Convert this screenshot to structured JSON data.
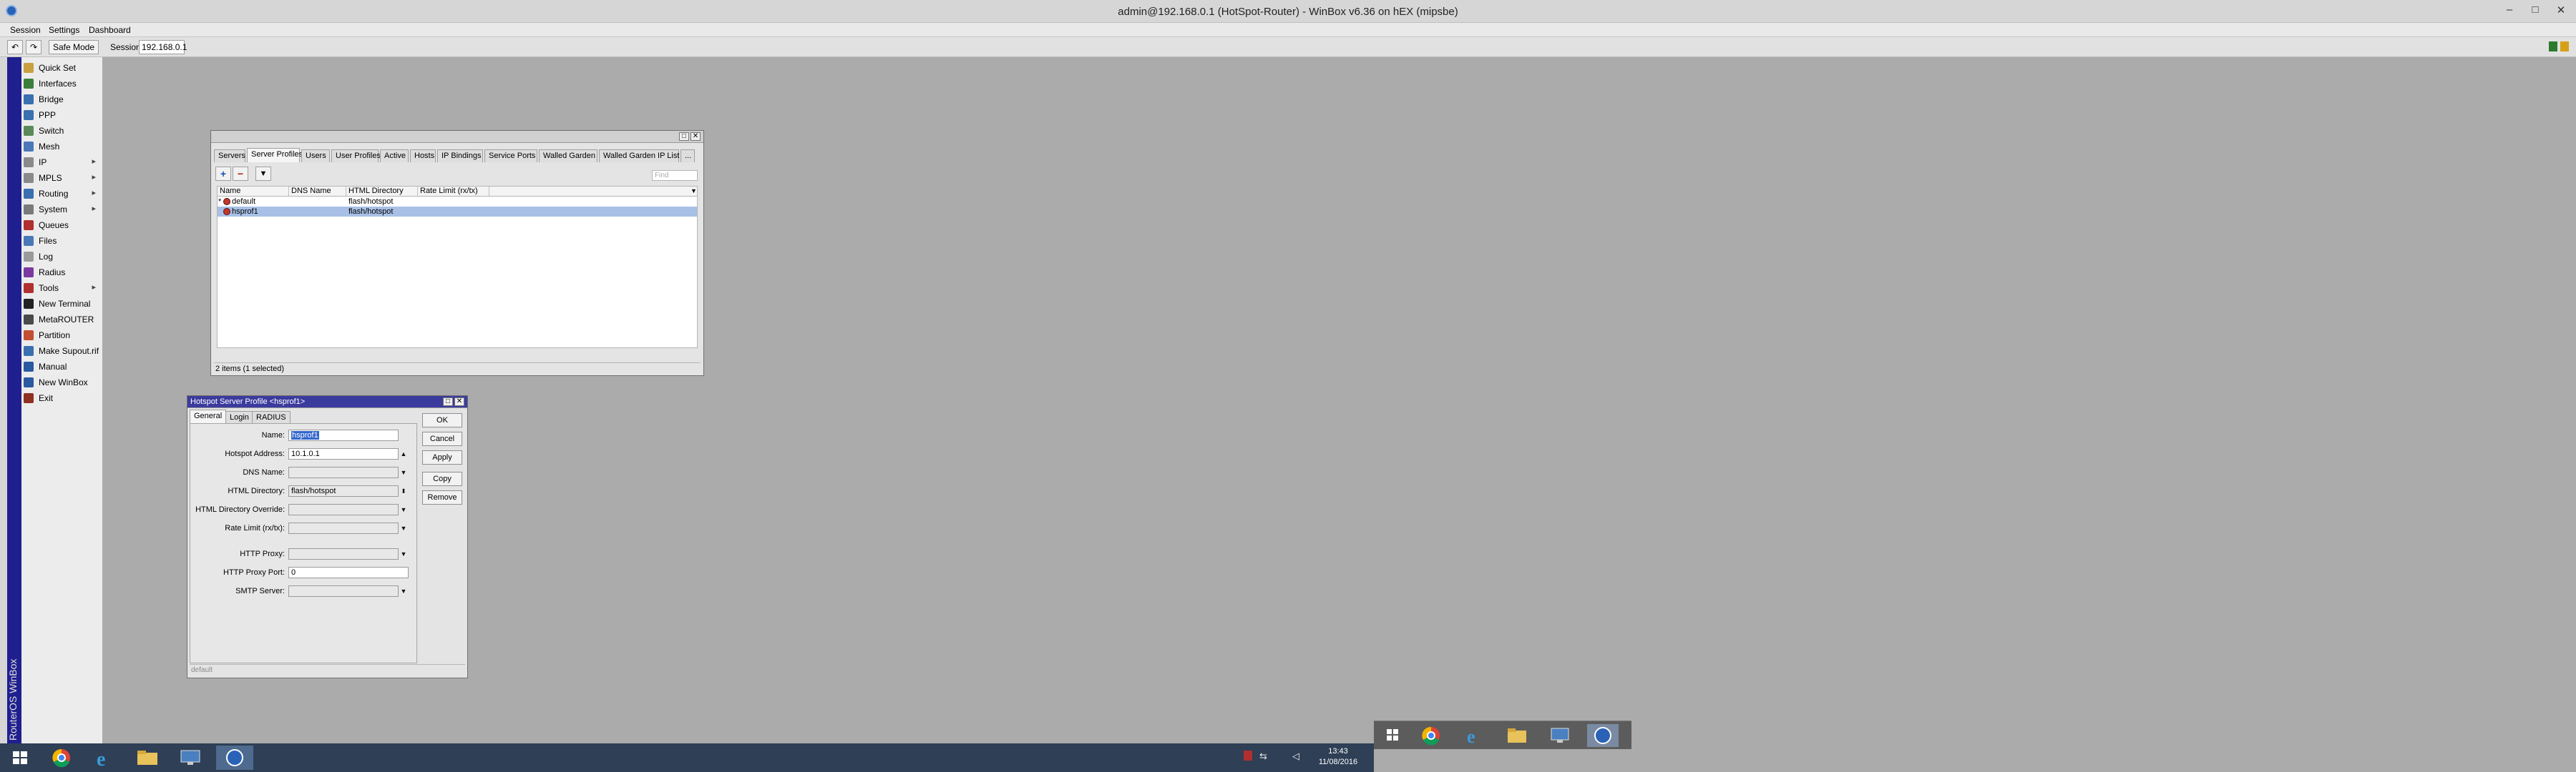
{
  "window": {
    "title": "admin@192.168.0.1 (HotSpot-Router) - WinBox v6.36 on hEX (mipsbe)",
    "controls": [
      "–",
      "□",
      "✕"
    ]
  },
  "menubar": {
    "items": [
      "Session",
      "Settings",
      "Dashboard"
    ]
  },
  "toolbar": {
    "undo": "↶",
    "redo": "↷",
    "safe_mode": "Safe Mode",
    "session_label": "Session:",
    "session_value": "192.168.0.1"
  },
  "brand_vertical": "RouterOS WinBox",
  "sidebar": {
    "items": [
      {
        "label": "Quick Set",
        "icon": "quickset-icon",
        "color": "#c8a040",
        "arrow": ""
      },
      {
        "label": "Interfaces",
        "icon": "interfaces-icon",
        "color": "#3c7f3c",
        "arrow": ""
      },
      {
        "label": "Bridge",
        "icon": "bridge-icon",
        "color": "#3a6fb0",
        "arrow": ""
      },
      {
        "label": "PPP",
        "icon": "ppp-icon",
        "color": "#3a6fb0",
        "arrow": ""
      },
      {
        "label": "Switch",
        "icon": "switch-icon",
        "color": "#5a8a5a",
        "arrow": ""
      },
      {
        "label": "Mesh",
        "icon": "mesh-icon",
        "color": "#4a78b8",
        "arrow": ""
      },
      {
        "label": "IP",
        "icon": "ip-icon",
        "color": "#8a8a8a",
        "arrow": "▸"
      },
      {
        "label": "MPLS",
        "icon": "mpls-icon",
        "color": "#8a8a8a",
        "arrow": "▸"
      },
      {
        "label": "Routing",
        "icon": "routing-icon",
        "color": "#3a6fb0",
        "arrow": "▸"
      },
      {
        "label": "System",
        "icon": "system-icon",
        "color": "#7a7a7a",
        "arrow": "▸"
      },
      {
        "label": "Queues",
        "icon": "queues-icon",
        "color": "#b03030",
        "arrow": ""
      },
      {
        "label": "Files",
        "icon": "files-icon",
        "color": "#4a78b8",
        "arrow": ""
      },
      {
        "label": "Log",
        "icon": "log-icon",
        "color": "#9a9a9a",
        "arrow": ""
      },
      {
        "label": "Radius",
        "icon": "radius-icon",
        "color": "#7a3aa0",
        "arrow": ""
      },
      {
        "label": "Tools",
        "icon": "tools-icon",
        "color": "#b03030",
        "arrow": "▸"
      },
      {
        "label": "New Terminal",
        "icon": "terminal-icon",
        "color": "#222222",
        "arrow": ""
      },
      {
        "label": "MetaROUTER",
        "icon": "metarouter-icon",
        "color": "#4a4a4a",
        "arrow": ""
      },
      {
        "label": "Partition",
        "icon": "partition-icon",
        "color": "#c05030",
        "arrow": ""
      },
      {
        "label": "Make Supout.rif",
        "icon": "supout-icon",
        "color": "#3a6fb0",
        "arrow": ""
      },
      {
        "label": "Manual",
        "icon": "manual-icon",
        "color": "#2a5aa0",
        "arrow": ""
      },
      {
        "label": "New WinBox",
        "icon": "winbox-icon",
        "color": "#2a5aa0",
        "arrow": ""
      },
      {
        "label": "Exit",
        "icon": "exit-icon",
        "color": "#903020",
        "arrow": ""
      }
    ]
  },
  "hotspot_window": {
    "title": "",
    "tabs": [
      "Servers",
      "Server Profiles",
      "Users",
      "User Profiles",
      "Active",
      "Hosts",
      "IP Bindings",
      "Service Ports",
      "Walled Garden",
      "Walled Garden IP List",
      "..."
    ],
    "selected_tab": 1,
    "buttons": {
      "add": "+",
      "remove": "−",
      "filter": "▼"
    },
    "find_placeholder": "Find",
    "columns": [
      "Name",
      "DNS Name",
      "HTML Directory",
      "Rate Limit (rx/tx)"
    ],
    "rows": [
      {
        "marker": "*",
        "name": "default",
        "dns": "",
        "html_dir": "flash/hotspot",
        "rate": "",
        "selected": false
      },
      {
        "marker": "",
        "name": "hsprof1",
        "dns": "",
        "html_dir": "flash/hotspot",
        "rate": "",
        "selected": true
      }
    ],
    "status": "2 items (1 selected)"
  },
  "profile_dialog": {
    "title": "Hotspot Server Profile <hsprof1>",
    "tabs": [
      "General",
      "Login",
      "RADIUS"
    ],
    "fields": {
      "name_label": "Name:",
      "name_value": "hsprof1",
      "address_label": "Hotspot Address:",
      "address_value": "10.1.0.1",
      "dns_label": "DNS Name:",
      "dns_value": "",
      "htmldir_label": "HTML Directory:",
      "htmldir_value": "flash/hotspot",
      "override_label": "HTML Directory Override:",
      "override_value": "",
      "rate_label": "Rate Limit (rx/tx):",
      "rate_value": "",
      "proxy_label": "HTTP Proxy:",
      "proxy_value": "",
      "proxyport_label": "HTTP Proxy Port:",
      "proxyport_value": "0",
      "smtp_label": "SMTP Server:",
      "smtp_value": ""
    },
    "buttons": [
      "OK",
      "Cancel",
      "Apply",
      "Copy",
      "Remove"
    ],
    "status": "default"
  },
  "clock": {
    "time": "13:43",
    "date": "11/08/2016"
  },
  "colors": {
    "accent": "#3b3b9e",
    "selection": "#a8c0e6",
    "taskbar": "#2e3f56"
  }
}
